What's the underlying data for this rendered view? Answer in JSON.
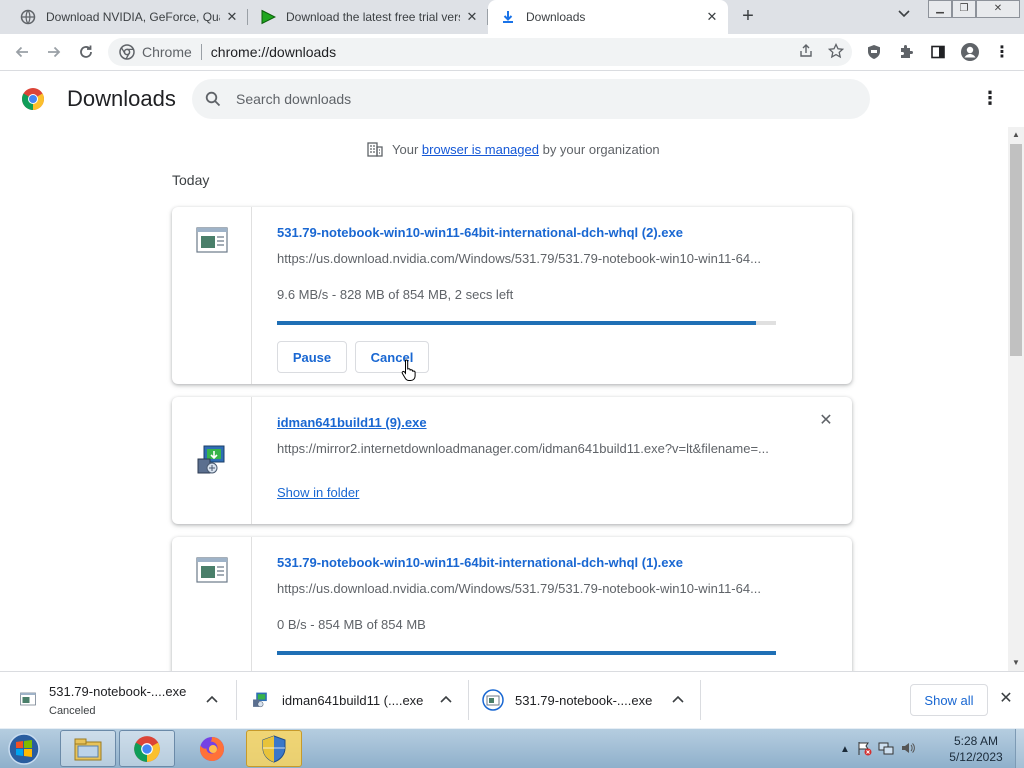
{
  "tabs": [
    {
      "title": "Download NVIDIA, GeForce, Quadro",
      "icon": "globe-icon"
    },
    {
      "title": "Download the latest free trial version",
      "icon": "play-icon"
    },
    {
      "title": "Downloads",
      "icon": "download-icon"
    }
  ],
  "toolbar": {
    "site_label": "Chrome",
    "url": "chrome://downloads"
  },
  "page": {
    "title": "Downloads",
    "search_placeholder": "Search downloads"
  },
  "managed": {
    "prefix": "Your",
    "link": "browser is managed",
    "suffix": "by your organization"
  },
  "section_label": "Today",
  "downloads": [
    {
      "name": "531.79-notebook-win10-win11-64bit-international-dch-whql (2).exe",
      "url": "https://us.download.nvidia.com/Windows/531.79/531.79-notebook-win10-win11-64...",
      "status": "9.6 MB/s - 828 MB of 854 MB, 2 secs left",
      "progress": 0.96,
      "pause_label": "Pause",
      "cancel_label": "Cancel"
    },
    {
      "name": "idman641build11 (9).exe",
      "url": "https://mirror2.internetdownloadmanager.com/idman641build11.exe?v=lt&filename=...",
      "show_in_folder": "Show in folder"
    },
    {
      "name": "531.79-notebook-win10-win11-64bit-international-dch-whql (1).exe",
      "url": "https://us.download.nvidia.com/Windows/531.79/531.79-notebook-win10-win11-64...",
      "status": "0 B/s - 854 MB of 854 MB",
      "progress": 1.0
    }
  ],
  "shelf": {
    "items": [
      {
        "name": "531.79-notebook-....exe",
        "sub": "Canceled"
      },
      {
        "name": "idman641build11 (....exe"
      },
      {
        "name": "531.79-notebook-....exe"
      }
    ],
    "show_all": "Show all"
  },
  "clock": {
    "time": "5:28 AM",
    "date": "5/12/2023"
  },
  "colors": {
    "accent": "#1967d2",
    "progress": "#1f6fb5"
  }
}
